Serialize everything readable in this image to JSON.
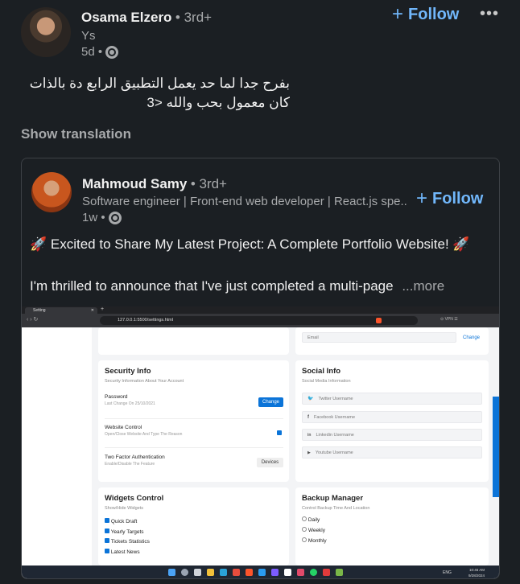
{
  "post": {
    "author_name": "Osama Elzero",
    "author_degree": "• 3rd+",
    "author_headline": "Ys",
    "time": "5d •",
    "follow_label": "Follow",
    "more_icon": "ellipsis-icon",
    "text_line1": "بفرح جدا لما حد يعمل التطبيق الرابع دة بالذات",
    "text_line2": "كان معمول بحب والله <3",
    "show_translation": "Show translation"
  },
  "shared": {
    "author_name": "Mahmoud Samy",
    "author_degree": "• 3rd+",
    "author_headline": "Software engineer | Front-end web developer | React.js spe...",
    "time": "1w •",
    "follow_label": "Follow",
    "text_line1": "🚀 Excited to Share My Latest Project: A Complete Portfolio Website! 🚀",
    "text_line2": "I'm thrilled to announce that I've just completed a multi-page",
    "more_label": "...more"
  },
  "screenshot": {
    "tab_title": "Setting",
    "url": "127.0.0.1:5500/settings.html",
    "top": {
      "email_placeholder": "Email",
      "change_label": "Change"
    },
    "security": {
      "title": "Security Info",
      "subtitle": "Security Information About Your Account",
      "password_label": "Password",
      "password_sub": "Last Change On 25/10/2021",
      "password_button": "Change",
      "website_label": "Website Control",
      "website_sub": "Open/Close Website And Type The Reason",
      "twofa_label": "Two Factor Authentication",
      "twofa_sub": "Enable/Disable The Feature",
      "twofa_button": "Devices"
    },
    "social": {
      "title": "Social Info",
      "subtitle": "Social Media Information",
      "fields": [
        "Twitter Username",
        "Facebook Username",
        "Linkedin Username",
        "Youtube Username"
      ]
    },
    "widgets": {
      "title": "Widgets Control",
      "subtitle": "Show/Hide Widgets",
      "items": [
        "Quick Draft",
        "Yearly Targets",
        "Tickets Statistics",
        "Latest News"
      ]
    },
    "backup": {
      "title": "Backup Manager",
      "subtitle": "Control Backup Time And Location",
      "items": [
        "Daily",
        "Weekly",
        "Monthly"
      ]
    },
    "taskbar": {
      "lang": "ENG",
      "time": "10:46 AM",
      "date": "9/28/2024"
    }
  }
}
